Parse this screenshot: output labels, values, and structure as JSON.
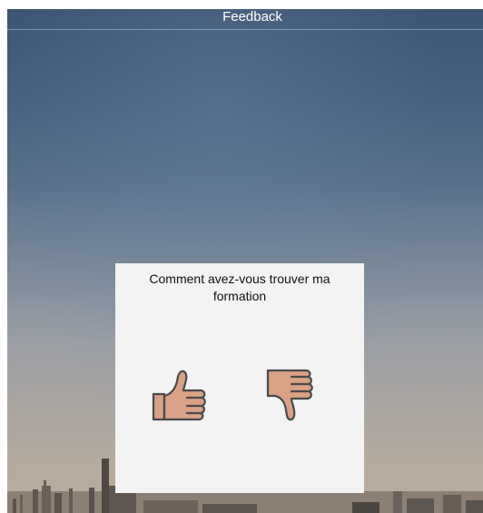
{
  "header": {
    "title": "Feedback"
  },
  "dialog": {
    "question": "Comment avez-vous trouver ma formation",
    "options": [
      {
        "icon": "thumbs-up-icon"
      },
      {
        "icon": "thumbs-down-icon"
      }
    ]
  },
  "colors": {
    "sky_top": "#3c5474",
    "sky_bottom": "#b9ac9c",
    "dialog_bg": "#f3f3f3",
    "thumb_fill": "#d9a186",
    "thumb_outline": "#4a4a4a"
  }
}
